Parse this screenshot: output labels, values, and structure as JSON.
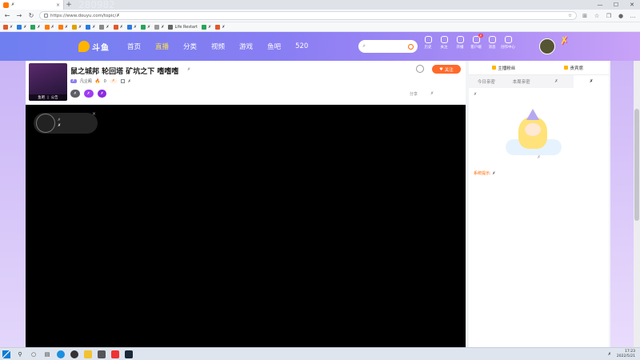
{
  "browser": {
    "tab_title": "✗",
    "new_tab": "+",
    "url": "https://www.douyu.com/topic/✗",
    "overlay_text": "280982",
    "bookmarks": [
      {
        "label": "✗",
        "color": "#e05a2a"
      },
      {
        "label": "✗",
        "color": "#2a7be0"
      },
      {
        "label": "✗",
        "color": "#29a35a"
      },
      {
        "label": "✗",
        "color": "#ff7a00"
      },
      {
        "label": "✗",
        "color": "#ff7a00"
      },
      {
        "label": "✗",
        "color": "#e0a000"
      },
      {
        "label": "✗",
        "color": "#2a7be0"
      },
      {
        "label": "✗",
        "color": "#888888"
      },
      {
        "label": "✗",
        "color": "#e05a2a"
      },
      {
        "label": "✗",
        "color": "#2a7be0"
      },
      {
        "label": "✗",
        "color": "#29a35a"
      },
      {
        "label": "✗",
        "color": "#999999"
      },
      {
        "label": "Life Restart",
        "color": "#666666"
      },
      {
        "label": "✗",
        "color": "#29a35a"
      },
      {
        "label": "✗",
        "color": "#e05a2a"
      }
    ]
  },
  "header": {
    "logo_text": "斗鱼",
    "nav": [
      "首页",
      "直播",
      "分类",
      "视频",
      "游戏",
      "鱼吧",
      "520"
    ],
    "search_placeholder": "✗",
    "icons": [
      {
        "label": "历史",
        "icon": "history-icon"
      },
      {
        "label": "关注",
        "icon": "follow-icon"
      },
      {
        "label": "开播",
        "icon": "broadcast-icon"
      },
      {
        "label": "客户端",
        "icon": "client-icon",
        "badge": "✗"
      },
      {
        "label": "消息",
        "icon": "message-icon"
      },
      {
        "label": "创作中心",
        "icon": "creator-icon"
      }
    ],
    "banner_text": "✗"
  },
  "room": {
    "avatar_caption": [
      "鱼吧",
      "公告"
    ],
    "title": "鼠之城邦 轮回塔 矿坑之下 嗜嗜嗜",
    "category": "✗",
    "follow_label": "关注",
    "level_badge": "✗",
    "streamer_name": "凡尘阁",
    "heat": "0",
    "rank_tag": "✗",
    "home_text": "✗",
    "pills": [
      "✗",
      "✗",
      "✗"
    ],
    "share_label": "分享",
    "report_label": "✗"
  },
  "video": {
    "notice_line1": "✗",
    "notice_line2": "✗",
    "close": "×"
  },
  "sidebar": {
    "tabs_top": [
      "主播粉丝",
      "贵宾席"
    ],
    "rank_tabs": [
      "今日亲密",
      "本周亲密",
      "✗",
      "✗"
    ],
    "active_rank_tab": 3,
    "fan_title": "✗",
    "empty_tip": "✗",
    "sys_label": "系统提示:",
    "sys_text": "✗"
  },
  "taskbar": {
    "time": "17:23",
    "date": "2022/5/21",
    "tray": "✗"
  }
}
